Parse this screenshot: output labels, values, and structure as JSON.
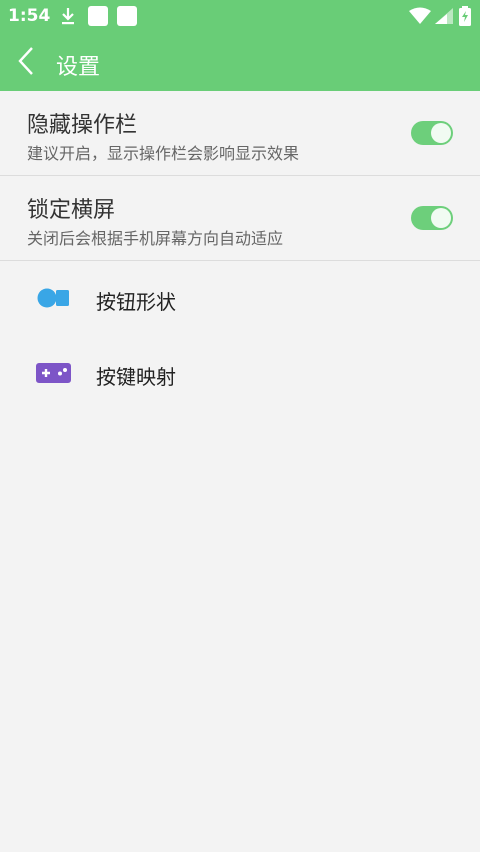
{
  "status_bar": {
    "time": "1:54",
    "icons": [
      "download-icon",
      "notification-square-icon",
      "notification-square-icon",
      "wifi-icon",
      "signal-icon",
      "battery-charging-icon"
    ]
  },
  "app_bar": {
    "title": "设置",
    "back_icon": "chevron-left-icon",
    "background": "#69cd77"
  },
  "settings": {
    "hide_toolbar": {
      "title": "隐藏操作栏",
      "subtitle": "建议开启，显示操作栏会影响显示效果",
      "enabled": true
    },
    "lock_landscape": {
      "title": "锁定横屏",
      "subtitle": "关闭后会根据手机屏幕方向自动适应",
      "enabled": true
    }
  },
  "menu": {
    "items": [
      {
        "label": "按钮形状",
        "icon": "button-shape-icon",
        "icon_color": "#39a6e6"
      },
      {
        "label": "按键映射",
        "icon": "gamepad-icon",
        "icon_color": "#7d55c7"
      }
    ]
  },
  "colors": {
    "accent": "#69cd77",
    "switch_on": "#6dcf7b",
    "background": "#f3f3f3"
  }
}
